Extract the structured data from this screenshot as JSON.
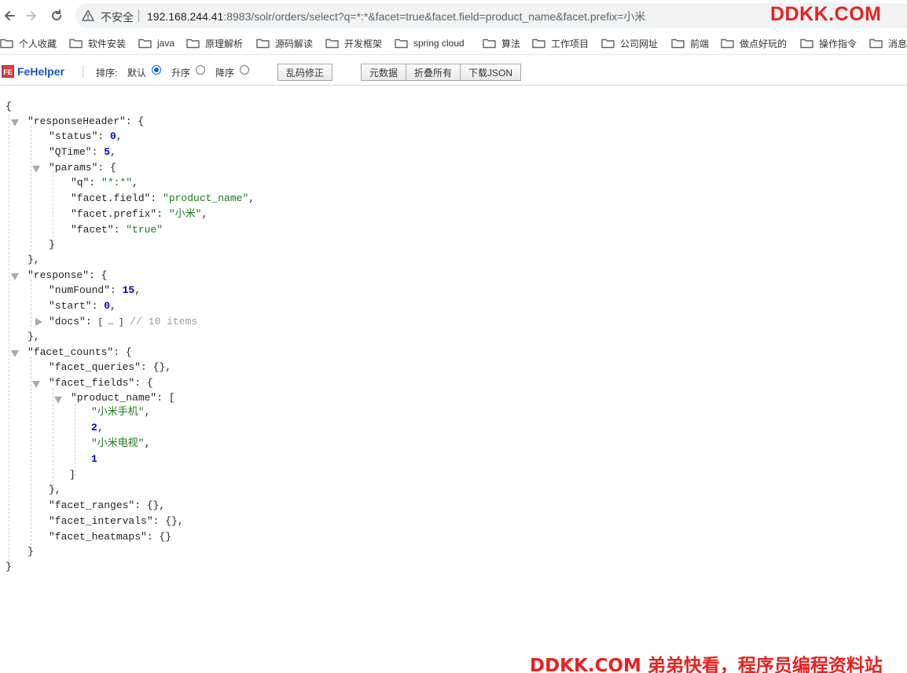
{
  "browser": {
    "insecure_label": "不安全",
    "url_host": "192.168.244.41",
    "url_rest": ":8983/solr/orders/select?q=*:*&facet=true&facet.field=product_name&facet.prefix=小米",
    "back_icon": "arrow-left-icon",
    "forward_icon": "arrow-right-icon",
    "reload_icon": "reload-icon",
    "warning_icon": "warning-icon"
  },
  "watermark": {
    "top": "DDKK.COM",
    "bottom": "DDKK.COM 弟弟快看，程序员编程资料站"
  },
  "bookmarks": {
    "items": [
      {
        "label": "个人收藏"
      },
      {
        "label": "软件安装"
      },
      {
        "label": "java"
      },
      {
        "label": "原理解析"
      },
      {
        "label": "源码解读"
      },
      {
        "label": "开发框架"
      },
      {
        "label": "spring cloud"
      },
      {
        "label": "算法"
      },
      {
        "label": "工作项目"
      },
      {
        "label": "公司网址"
      },
      {
        "label": "前端"
      },
      {
        "label": "做点好玩的"
      },
      {
        "label": "操作指令"
      },
      {
        "label": "消息"
      }
    ]
  },
  "fehelper": {
    "logo_text": "FE",
    "name": "FeHelper",
    "sort_label": "排序:",
    "sort_default": "默认",
    "sort_asc": "升序",
    "sort_desc": "降序",
    "sort_selected": "默认",
    "btn_fix_encoding": "乱码修正",
    "btn_raw": "元数据",
    "btn_collapse_all": "折叠所有",
    "btn_download": "下载JSON"
  },
  "json": {
    "open_brace": "{",
    "close_brace": "}",
    "responseHeader_key": "\"responseHeader\"",
    "status_key": "\"status\"",
    "status_val": "0",
    "qtime_key": "\"QTime\"",
    "qtime_val": "5",
    "params_key": "\"params\"",
    "q_key": "\"q\"",
    "q_val": "\"*:*\"",
    "facet_field_key": "\"facet.field\"",
    "facet_field_val": "\"product_name\"",
    "facet_prefix_key": "\"facet.prefix\"",
    "facet_prefix_val": "\"小米\"",
    "facet_key": "\"facet\"",
    "facet_val": "\"true\"",
    "response_key": "\"response\"",
    "numFound_key": "\"numFound\"",
    "numFound_val": "15",
    "start_key": "\"start\"",
    "start_val": "0",
    "docs_key": "\"docs\"",
    "docs_collapsed": "[ … ]",
    "docs_comment": "// 10 items",
    "facet_counts_key": "\"facet_counts\"",
    "facet_queries_key": "\"facet_queries\"",
    "facet_fields_key": "\"facet_fields\"",
    "product_name_key": "\"product_name\"",
    "pn_item1": "\"小米手机\"",
    "pn_item2": "2",
    "pn_item3": "\"小米电视\"",
    "pn_item4": "1",
    "facet_ranges_key": "\"facet_ranges\"",
    "facet_intervals_key": "\"facet_intervals\"",
    "facet_heatmaps_key": "\"facet_heatmaps\""
  }
}
